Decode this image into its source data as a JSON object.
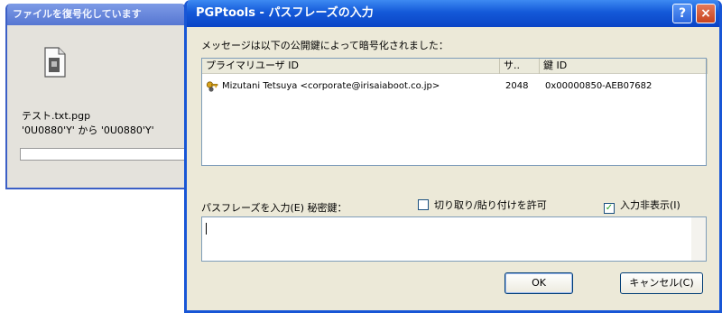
{
  "background_window": {
    "title": "ファイルを復号化しています",
    "file_name": "テスト.txt.pgp",
    "progress_text": "'0U0880'Y' から '0U0880'Y'",
    "progress": 0.0
  },
  "dialog": {
    "title": "PGPtools - パスフレーズの入力",
    "help_glyph": "?",
    "close_glyph": "×",
    "message": "メッセージは以下の公開鍵によって暗号化されました：",
    "columns": [
      "プライマリユーザ ID",
      "サ..",
      "鍵 ID"
    ],
    "recipients": [
      {
        "user_id": "Mizutani Tetsuya <corporate@irisaiaboot.co.jp>",
        "size": "2048",
        "key_id": "0x00000850-AEB07682",
        "icon": "key-pair-icon"
      }
    ],
    "passphrase_label": "パスフレーズを入力(E) 秘密鍵：",
    "checkboxes": [
      {
        "label": "切り取り/貼り付けを許可",
        "checked": false
      },
      {
        "label": "入力非表示(I)",
        "checked": true
      }
    ],
    "passphrase_value": "",
    "ok_label": "OK",
    "cancel_label": "キャンセル(C)"
  }
}
